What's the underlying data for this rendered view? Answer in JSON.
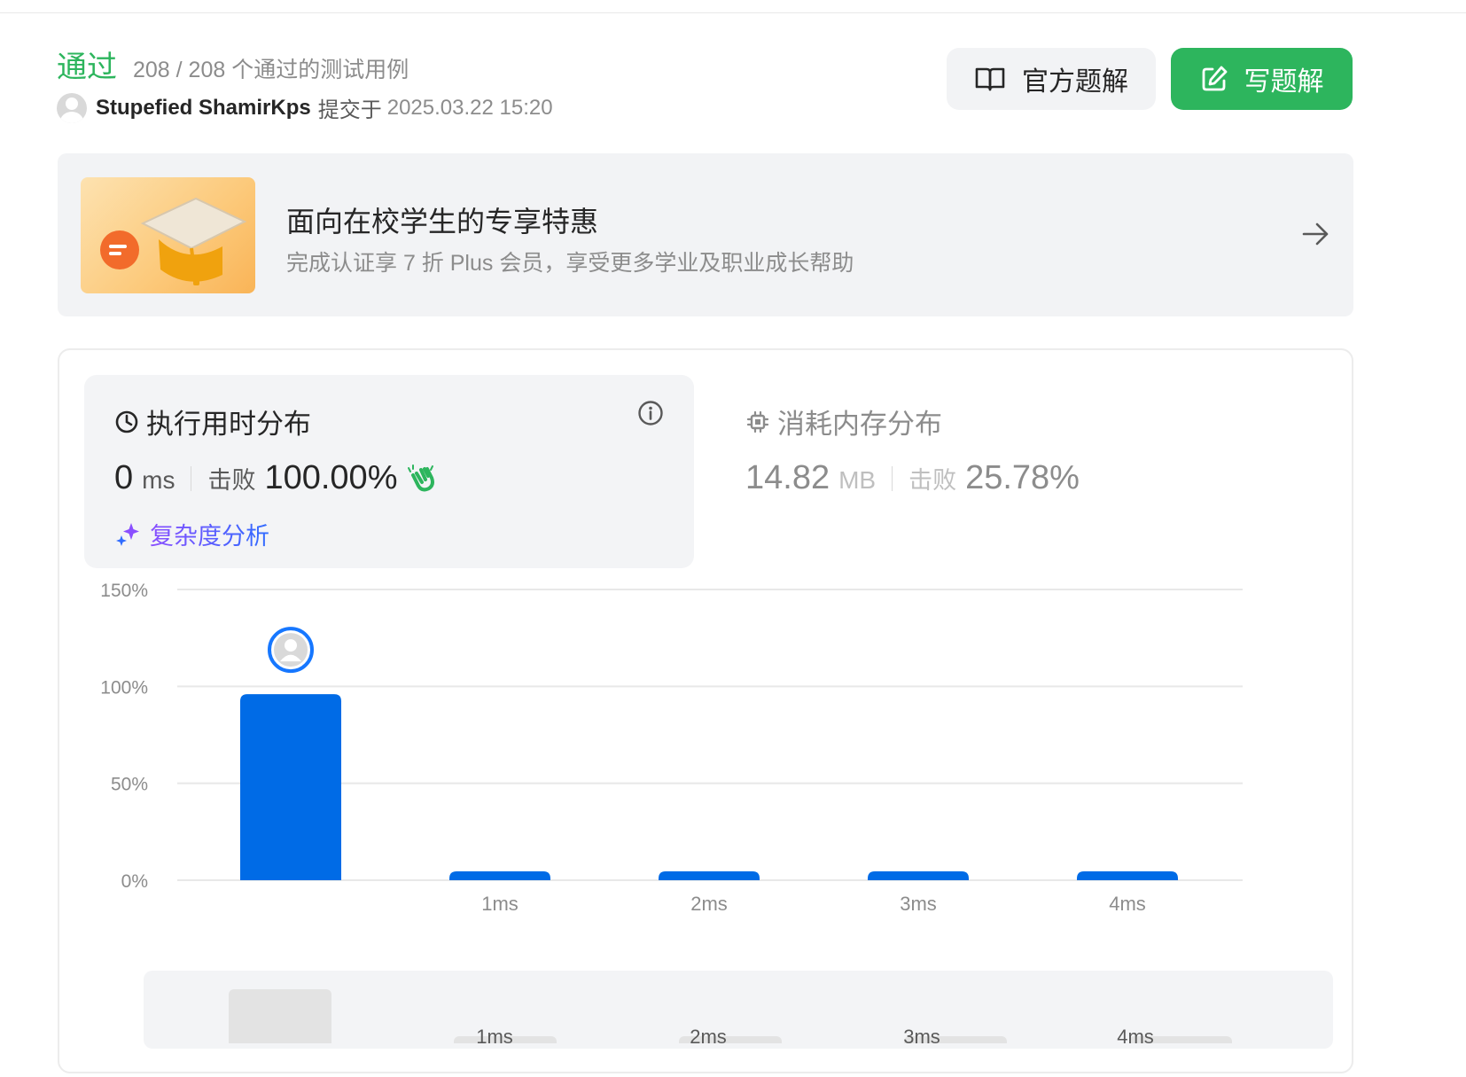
{
  "header": {
    "status": "通过",
    "testcases": "208 / 208 个通过的测试用例",
    "username": "Stupefied ShamirKps",
    "submitted_label": "提交于",
    "submitted_time": "2025.03.22 15:20",
    "official_solution_label": "官方题解",
    "write_solution_label": "写题解"
  },
  "promo": {
    "title": "面向在校学生的专享特惠",
    "subtitle": "完成认证享 7 折 Plus 会员，享受更多学业及职业成长帮助"
  },
  "runtime": {
    "title": "执行用时分布",
    "value": "0",
    "unit": "ms",
    "beats_label": "击败",
    "beats_pct": "100.00%",
    "complexity_label": "复杂度分析"
  },
  "memory": {
    "title": "消耗内存分布",
    "value": "14.82",
    "unit": "MB",
    "beats_label": "击败",
    "beats_pct": "25.78%"
  },
  "colors": {
    "accent": "#2db55d",
    "bar": "#006be6"
  },
  "chart_data": {
    "type": "bar",
    "categories": [
      "",
      "1ms",
      "2ms",
      "3ms",
      "4ms"
    ],
    "values": [
      96,
      2,
      2,
      2,
      2
    ],
    "ylim": [
      0,
      150
    ],
    "yticks": [
      "0%",
      "50%",
      "100%",
      "150%"
    ],
    "grid": true,
    "highlight_index": 0,
    "mini_labels": [
      "1ms",
      "2ms",
      "3ms",
      "4ms"
    ]
  }
}
